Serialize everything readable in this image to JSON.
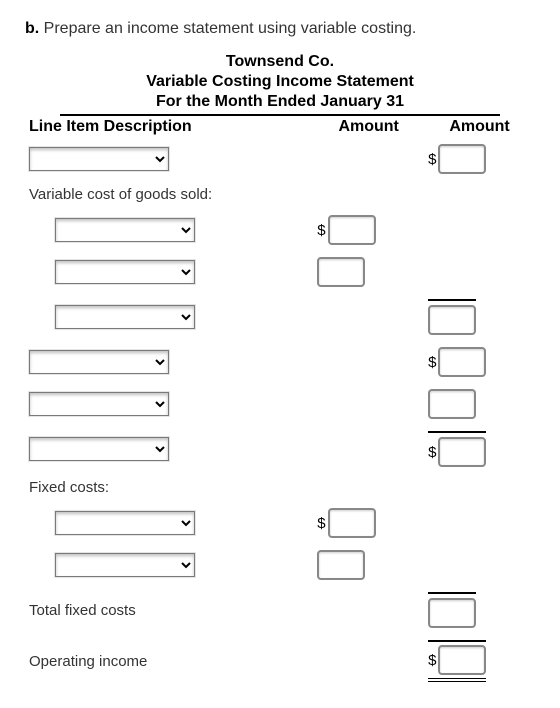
{
  "prompt": {
    "letter": "b.",
    "text": "Prepare an income statement using variable costing."
  },
  "header": {
    "company": "Townsend Co.",
    "title": "Variable Costing Income Statement",
    "period": "For the Month Ended January 31"
  },
  "columns": {
    "desc": "Line Item Description",
    "amt1": "Amount",
    "amt2": "Amount"
  },
  "labels": {
    "vcogs": "Variable cost of goods sold:",
    "fixed": "Fixed costs:",
    "totalfixed": "Total fixed costs",
    "opinc": "Operating income"
  },
  "dollar": "$",
  "rows": {
    "r1": {
      "sel": "",
      "a2": ""
    },
    "r3": {
      "sel": "",
      "a1": ""
    },
    "r4": {
      "sel": "",
      "a1": ""
    },
    "r5": {
      "sel": "",
      "a2": ""
    },
    "r6": {
      "sel": "",
      "a2": ""
    },
    "r7": {
      "sel": "",
      "a2": ""
    },
    "r8": {
      "sel": "",
      "a2": ""
    },
    "r10": {
      "sel": "",
      "a1": ""
    },
    "r11": {
      "sel": "",
      "a1": ""
    },
    "r12": {
      "a2": ""
    },
    "r13": {
      "a2": ""
    }
  }
}
